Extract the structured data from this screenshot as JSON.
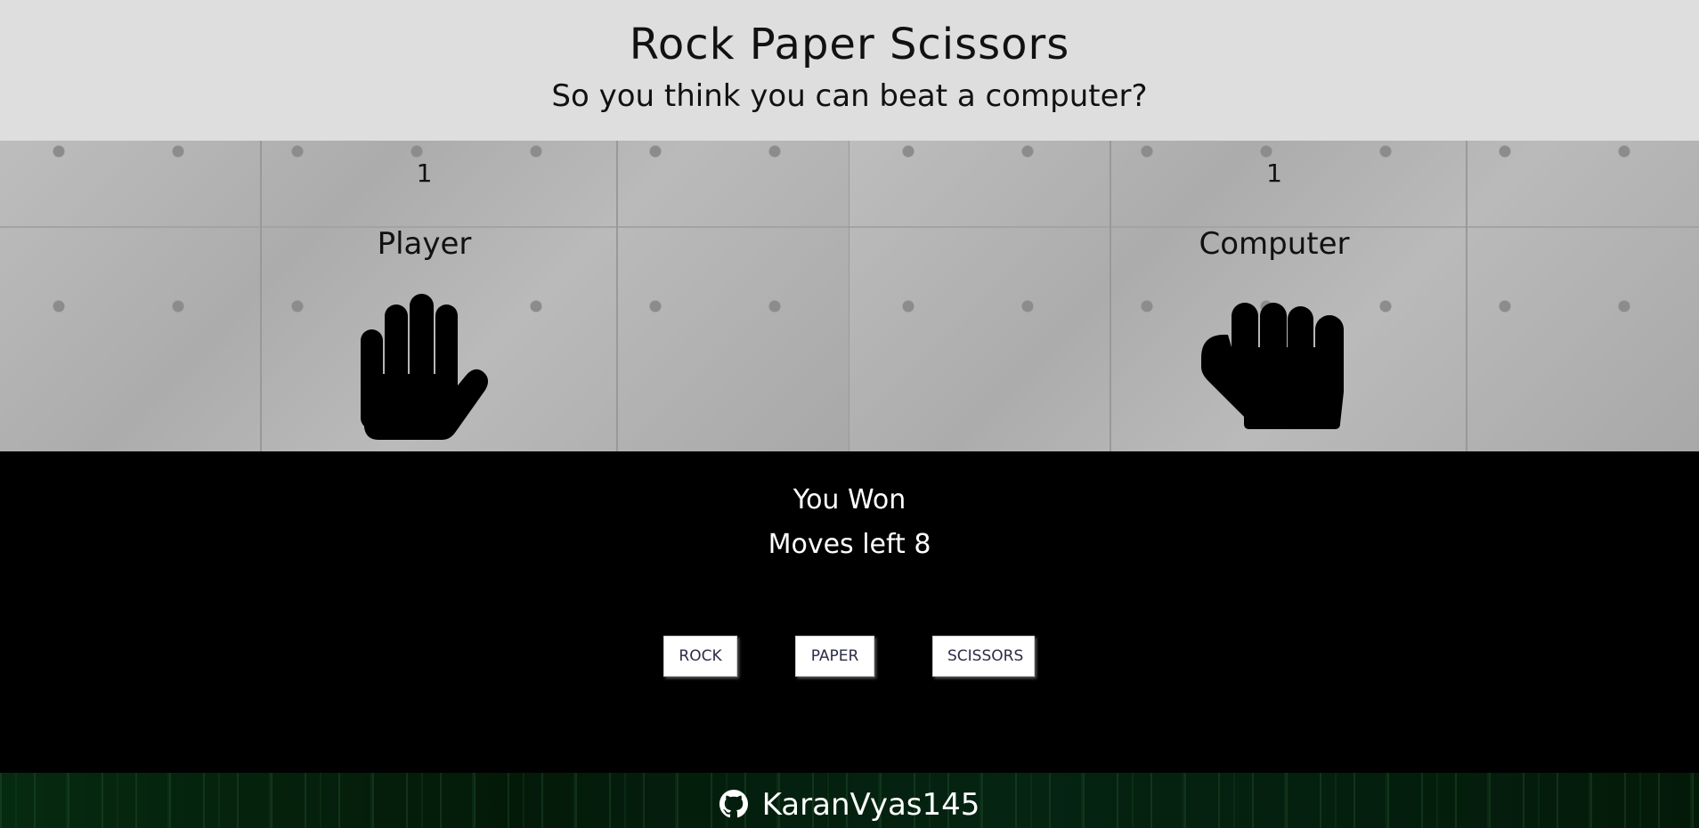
{
  "header": {
    "title": "Rock Paper Scissors",
    "subtitle": "So you think you can beat a computer?"
  },
  "player": {
    "score": "1",
    "label": "Player",
    "choice_icon": "hand-paper-icon"
  },
  "computer": {
    "score": "1",
    "label": "Computer",
    "choice_icon": "hand-rock-icon"
  },
  "status": {
    "result": "You Won",
    "moves_left": "Moves left 8"
  },
  "controls": {
    "rock_label": "ROCK",
    "paper_label": "PAPER",
    "scissors_label": "SCISSORS"
  },
  "footer": {
    "github_icon": "github-icon",
    "username": "KaranVyas145"
  },
  "colors": {
    "header_bg": "#dedede",
    "body_bg": "#000000",
    "button_text": "#2c2c48"
  }
}
